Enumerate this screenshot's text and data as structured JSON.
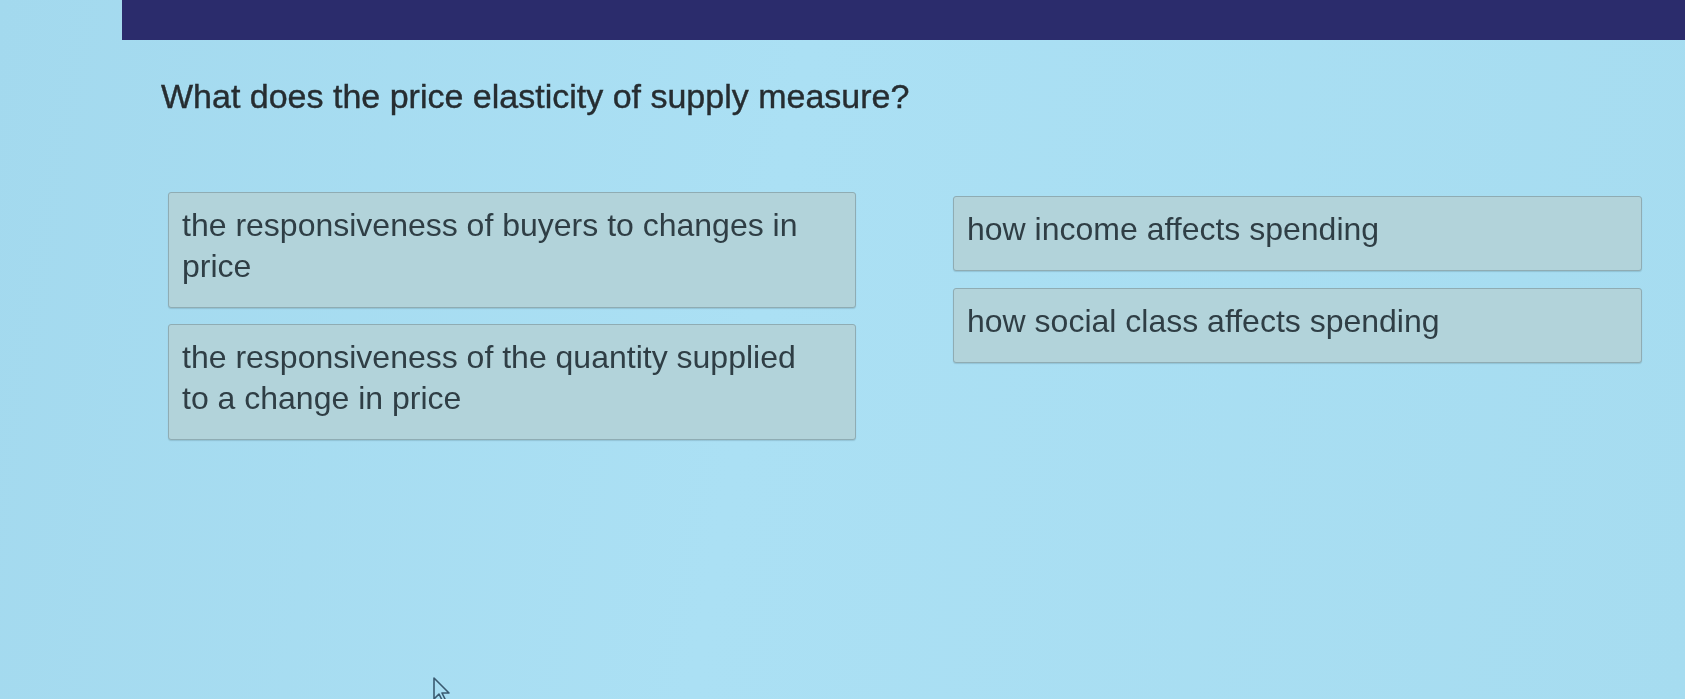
{
  "question": {
    "text": "What does the price elasticity of supply measure?"
  },
  "option_columns": [
    {
      "options": [
        {
          "text": "the responsiveness of buyers to changes in price"
        },
        {
          "text": "the responsiveness of the quantity supplied to a change in price"
        }
      ]
    },
    {
      "options": [
        {
          "text": "how income affects spending"
        },
        {
          "text": "how social class affects spending"
        }
      ]
    }
  ]
}
